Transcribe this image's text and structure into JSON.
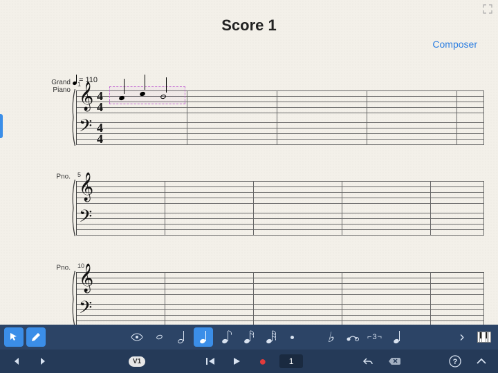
{
  "score": {
    "title": "Score 1",
    "composer_label": "Composer",
    "tempo_bpm": "= 110",
    "time_sig_top": "4",
    "time_sig_bottom": "4",
    "systems": [
      {
        "bar_number": "1",
        "instrument_label": "Grand Piano"
      },
      {
        "bar_number": "5",
        "instrument_label": "Pno."
      },
      {
        "bar_number": "10",
        "instrument_label": "Pno."
      }
    ]
  },
  "toolbar": {
    "selected_duration": "quarter",
    "tuplet_label": "⌐3¬"
  },
  "transport": {
    "measure_display": "1",
    "version_badge": "V1"
  }
}
